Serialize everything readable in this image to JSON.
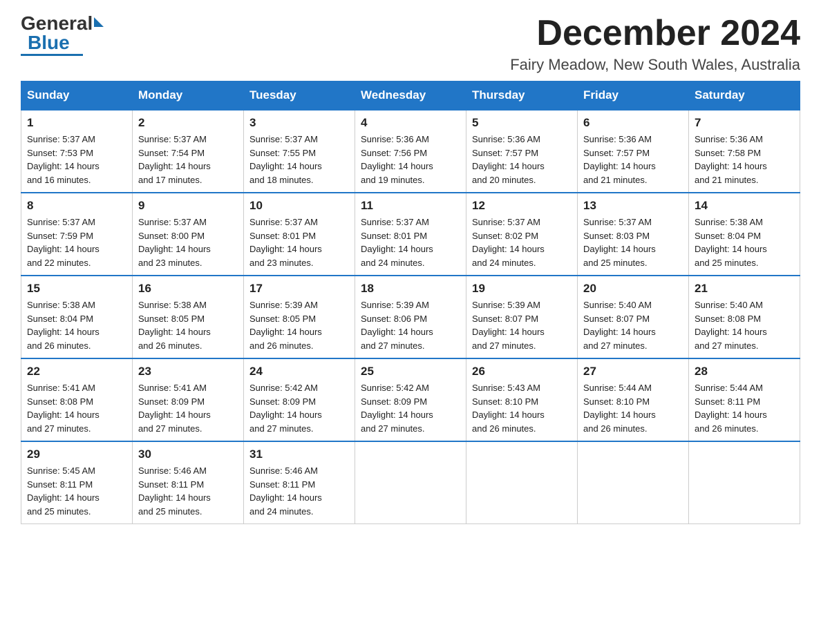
{
  "header": {
    "logo_general": "General",
    "logo_blue": "Blue",
    "month": "December 2024",
    "location": "Fairy Meadow, New South Wales, Australia"
  },
  "days_of_week": [
    "Sunday",
    "Monday",
    "Tuesday",
    "Wednesday",
    "Thursday",
    "Friday",
    "Saturday"
  ],
  "weeks": [
    [
      {
        "day": "1",
        "sunrise": "5:37 AM",
        "sunset": "7:53 PM",
        "daylight": "14 hours and 16 minutes."
      },
      {
        "day": "2",
        "sunrise": "5:37 AM",
        "sunset": "7:54 PM",
        "daylight": "14 hours and 17 minutes."
      },
      {
        "day": "3",
        "sunrise": "5:37 AM",
        "sunset": "7:55 PM",
        "daylight": "14 hours and 18 minutes."
      },
      {
        "day": "4",
        "sunrise": "5:36 AM",
        "sunset": "7:56 PM",
        "daylight": "14 hours and 19 minutes."
      },
      {
        "day": "5",
        "sunrise": "5:36 AM",
        "sunset": "7:57 PM",
        "daylight": "14 hours and 20 minutes."
      },
      {
        "day": "6",
        "sunrise": "5:36 AM",
        "sunset": "7:57 PM",
        "daylight": "14 hours and 21 minutes."
      },
      {
        "day": "7",
        "sunrise": "5:36 AM",
        "sunset": "7:58 PM",
        "daylight": "14 hours and 21 minutes."
      }
    ],
    [
      {
        "day": "8",
        "sunrise": "5:37 AM",
        "sunset": "7:59 PM",
        "daylight": "14 hours and 22 minutes."
      },
      {
        "day": "9",
        "sunrise": "5:37 AM",
        "sunset": "8:00 PM",
        "daylight": "14 hours and 23 minutes."
      },
      {
        "day": "10",
        "sunrise": "5:37 AM",
        "sunset": "8:01 PM",
        "daylight": "14 hours and 23 minutes."
      },
      {
        "day": "11",
        "sunrise": "5:37 AM",
        "sunset": "8:01 PM",
        "daylight": "14 hours and 24 minutes."
      },
      {
        "day": "12",
        "sunrise": "5:37 AM",
        "sunset": "8:02 PM",
        "daylight": "14 hours and 24 minutes."
      },
      {
        "day": "13",
        "sunrise": "5:37 AM",
        "sunset": "8:03 PM",
        "daylight": "14 hours and 25 minutes."
      },
      {
        "day": "14",
        "sunrise": "5:38 AM",
        "sunset": "8:04 PM",
        "daylight": "14 hours and 25 minutes."
      }
    ],
    [
      {
        "day": "15",
        "sunrise": "5:38 AM",
        "sunset": "8:04 PM",
        "daylight": "14 hours and 26 minutes."
      },
      {
        "day": "16",
        "sunrise": "5:38 AM",
        "sunset": "8:05 PM",
        "daylight": "14 hours and 26 minutes."
      },
      {
        "day": "17",
        "sunrise": "5:39 AM",
        "sunset": "8:05 PM",
        "daylight": "14 hours and 26 minutes."
      },
      {
        "day": "18",
        "sunrise": "5:39 AM",
        "sunset": "8:06 PM",
        "daylight": "14 hours and 27 minutes."
      },
      {
        "day": "19",
        "sunrise": "5:39 AM",
        "sunset": "8:07 PM",
        "daylight": "14 hours and 27 minutes."
      },
      {
        "day": "20",
        "sunrise": "5:40 AM",
        "sunset": "8:07 PM",
        "daylight": "14 hours and 27 minutes."
      },
      {
        "day": "21",
        "sunrise": "5:40 AM",
        "sunset": "8:08 PM",
        "daylight": "14 hours and 27 minutes."
      }
    ],
    [
      {
        "day": "22",
        "sunrise": "5:41 AM",
        "sunset": "8:08 PM",
        "daylight": "14 hours and 27 minutes."
      },
      {
        "day": "23",
        "sunrise": "5:41 AM",
        "sunset": "8:09 PM",
        "daylight": "14 hours and 27 minutes."
      },
      {
        "day": "24",
        "sunrise": "5:42 AM",
        "sunset": "8:09 PM",
        "daylight": "14 hours and 27 minutes."
      },
      {
        "day": "25",
        "sunrise": "5:42 AM",
        "sunset": "8:09 PM",
        "daylight": "14 hours and 27 minutes."
      },
      {
        "day": "26",
        "sunrise": "5:43 AM",
        "sunset": "8:10 PM",
        "daylight": "14 hours and 26 minutes."
      },
      {
        "day": "27",
        "sunrise": "5:44 AM",
        "sunset": "8:10 PM",
        "daylight": "14 hours and 26 minutes."
      },
      {
        "day": "28",
        "sunrise": "5:44 AM",
        "sunset": "8:11 PM",
        "daylight": "14 hours and 26 minutes."
      }
    ],
    [
      {
        "day": "29",
        "sunrise": "5:45 AM",
        "sunset": "8:11 PM",
        "daylight": "14 hours and 25 minutes."
      },
      {
        "day": "30",
        "sunrise": "5:46 AM",
        "sunset": "8:11 PM",
        "daylight": "14 hours and 25 minutes."
      },
      {
        "day": "31",
        "sunrise": "5:46 AM",
        "sunset": "8:11 PM",
        "daylight": "14 hours and 24 minutes."
      },
      null,
      null,
      null,
      null
    ]
  ],
  "labels": {
    "sunrise": "Sunrise:",
    "sunset": "Sunset:",
    "daylight": "Daylight:"
  }
}
